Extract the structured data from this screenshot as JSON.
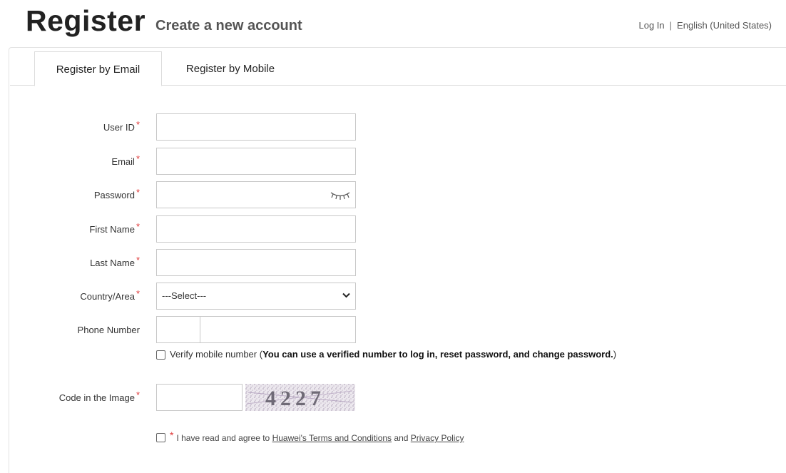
{
  "header": {
    "title": "Register",
    "subtitle": "Create a new account",
    "login_link": "Log In",
    "separator": "|",
    "language": "English (United States)"
  },
  "tabs": [
    {
      "label": "Register by Email",
      "active": true
    },
    {
      "label": "Register by Mobile",
      "active": false
    }
  ],
  "form": {
    "required_mark": "*",
    "user_id": {
      "label": "User ID",
      "value": ""
    },
    "email": {
      "label": "Email",
      "value": ""
    },
    "password": {
      "label": "Password",
      "value": ""
    },
    "first_name": {
      "label": "First Name",
      "value": ""
    },
    "last_name": {
      "label": "Last Name",
      "value": ""
    },
    "country": {
      "label": "Country/Area",
      "selected": "---Select---"
    },
    "phone": {
      "label": "Phone Number",
      "code": "",
      "number": ""
    },
    "verify": {
      "prefix": "Verify mobile number (",
      "bold": "You can use a verified number to log in, reset password, and change password.",
      "suffix": ")"
    },
    "captcha": {
      "label": "Code in the Image",
      "value": "",
      "code": "4227"
    },
    "agree": {
      "prefix": "I have read and agree to",
      "terms": "Huawei's Terms and Conditions",
      "and": "and",
      "privacy": "Privacy Policy"
    }
  },
  "colors": {
    "required": "#e03a3a",
    "border": "#c8c8c8"
  }
}
